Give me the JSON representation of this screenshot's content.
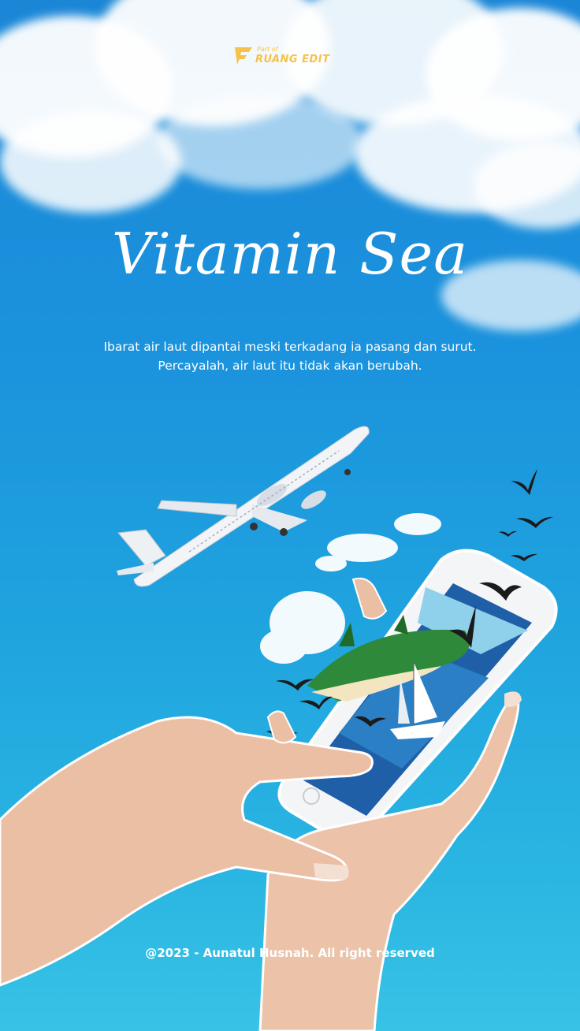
{
  "brand": {
    "logo_small": "Part of",
    "logo_big": "RUANG EDIT"
  },
  "poster": {
    "title": "Vitamin Sea",
    "subtitle": "Ibarat air laut dipantai meski terkadang ia pasang dan surut. Percayalah, air laut itu tidak akan berubah.",
    "footer": "@2023 - Aunatul Husnah. All right reserved"
  },
  "colors": {
    "sky_top": "#1b86d6",
    "sky_bottom": "#38c2e6",
    "logo_gold": "#f6c24a"
  },
  "icons": [
    "airplane-icon",
    "bird-icon",
    "smartphone-icon",
    "hand-icon",
    "sailboat-icon",
    "island-icon"
  ]
}
